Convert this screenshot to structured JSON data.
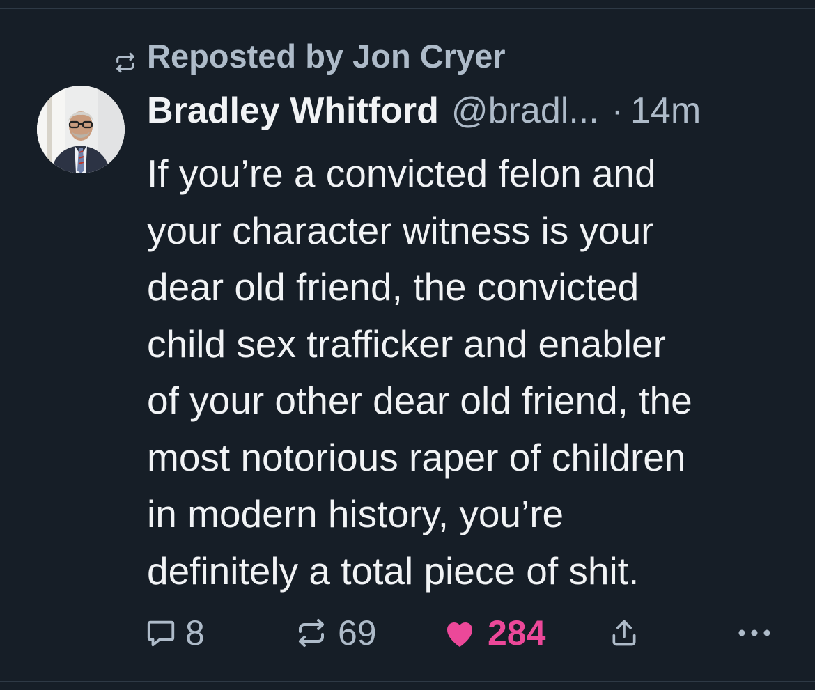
{
  "repost": {
    "icon": "repost-icon",
    "label": "Reposted by Jon Cryer"
  },
  "post": {
    "avatar_icon": "avatar",
    "display_name": "Bradley Whitford",
    "handle": "@bradl...",
    "separator": "·",
    "timestamp": "14m",
    "text_lines": [
      "If you’re a convicted felon and",
      "your character witness is your",
      "dear old friend, the convicted",
      "child sex trafficker and enabler",
      "of your other dear old friend, the",
      "most notorious raper of children",
      "in modern history, you’re",
      "definitely a total piece of shit."
    ]
  },
  "actions": {
    "reply": {
      "icon": "reply-bubble-icon",
      "count": "8"
    },
    "repost": {
      "icon": "repost-icon",
      "count": "69"
    },
    "like": {
      "icon": "heart-icon",
      "count": "284",
      "color": "#ec4899"
    },
    "share": {
      "icon": "share-icon"
    },
    "more": {
      "icon": "more-dots-icon"
    }
  },
  "colors": {
    "background": "#161e27",
    "primary_text": "#f1f3f5",
    "secondary_text": "#aebbc9",
    "like_active": "#ec4899"
  }
}
